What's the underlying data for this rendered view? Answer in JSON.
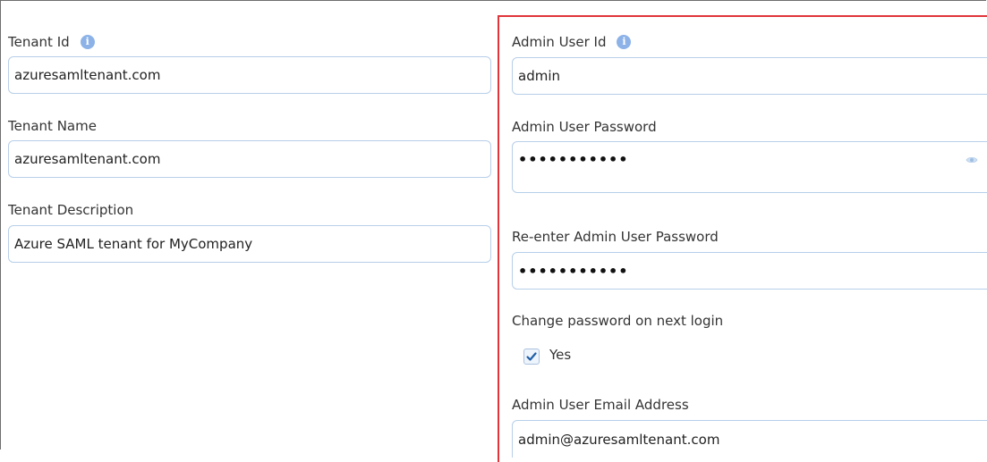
{
  "left": {
    "tenant_id_label": "Tenant Id",
    "tenant_id_value": "azuresamltenant.com",
    "tenant_name_label": "Tenant Name",
    "tenant_name_value": "azuresamltenant.com",
    "tenant_desc_label": "Tenant Description",
    "tenant_desc_value": "Azure SAML tenant for MyCompany"
  },
  "right": {
    "admin_user_id_label": "Admin User Id",
    "admin_user_id_value": "admin",
    "admin_password_label": "Admin User Password",
    "admin_password_value": "•••••••••••",
    "reenter_password_label": "Re-enter Admin User Password",
    "reenter_password_value": "•••••••••••",
    "change_password_label": "Change password on next login",
    "change_password_option": "Yes",
    "change_password_checked": true,
    "email_label": "Admin User Email Address",
    "email_value": "admin@azuresamltenant.com"
  },
  "icons": {
    "info": "info-icon",
    "eye": "eye-icon",
    "check": "checkmark-icon"
  },
  "colors": {
    "highlight_border": "#e0353a",
    "field_border": "#b7cfe9",
    "info_icon": "#8cb2e8",
    "checkmark": "#1f5fa8"
  }
}
